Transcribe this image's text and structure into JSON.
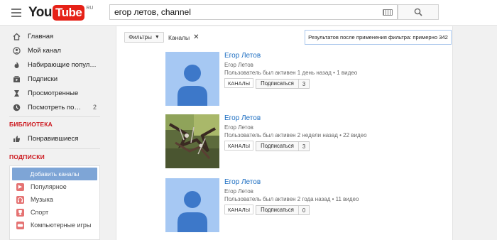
{
  "header": {
    "logo": {
      "you": "You",
      "tube": "Tube",
      "region": "RU"
    },
    "search_value": "егор летов, channel"
  },
  "sidebar": {
    "nav": [
      {
        "label": "Главная",
        "icon": "home-icon"
      },
      {
        "label": "Мой канал",
        "icon": "user-icon"
      },
      {
        "label": "Набирающие попул…",
        "icon": "flame-icon"
      },
      {
        "label": "Подписки",
        "icon": "subscriptions-icon"
      },
      {
        "label": "Просмотренные",
        "icon": "history-icon"
      },
      {
        "label": "Посмотреть по…",
        "icon": "clock-icon",
        "count": "2"
      }
    ],
    "library_title": "БИБЛИОТЕКА",
    "library_items": [
      {
        "label": "Понравившиеся",
        "icon": "thumbs-up-icon"
      }
    ],
    "subs_title": "ПОДПИСКИ",
    "add_channels": "Добавить каналы",
    "sub_items": [
      {
        "label": "Популярное",
        "icon": "play-icon"
      },
      {
        "label": "Музыка",
        "icon": "headphones-icon"
      },
      {
        "label": "Спорт",
        "icon": "trophy-icon"
      },
      {
        "label": "Компьютерные игры",
        "icon": "gamepad-icon"
      }
    ]
  },
  "filters": {
    "button_label": "Фильтры",
    "active_chip": "Каналы",
    "results_text": "Результатов после применения фильтра: примерно 342"
  },
  "results": [
    {
      "title": "Егор Летов",
      "owner": "Егор Летов",
      "meta": "Пользователь был активен 1 день назад • 1 видео",
      "badge": "КАНАЛЫ",
      "subscribe": "Подписаться",
      "subs_count": "3",
      "thumb": "default-avatar"
    },
    {
      "title": "Егор Летов",
      "owner": "Егор Летов",
      "meta": "Пользователь был активен 2 недели назад • 22 видео",
      "badge": "КАНАЛЫ",
      "subscribe": "Подписаться",
      "subs_count": "3",
      "thumb": "photo"
    },
    {
      "title": "Егор Летов",
      "owner": "Егор Летов",
      "meta": "Пользователь был активен 2 года назад • 11 видео",
      "badge": "КАНАЛЫ",
      "subscribe": "Подписаться",
      "subs_count": "0",
      "thumb": "default-avatar"
    }
  ],
  "colors": {
    "brand_red": "#e62117",
    "link_blue": "#1b6dc1",
    "avatar_bg": "#a6c8f3",
    "avatar_fg": "#3d78c9",
    "section_red": "#cc181e"
  }
}
